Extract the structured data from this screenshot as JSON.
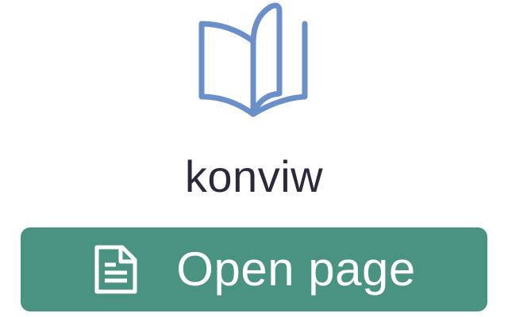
{
  "app": {
    "name": "konviw",
    "logo_icon": "open-book-icon",
    "accent_color": "#4a9382",
    "logo_color": "#6a8fc9"
  },
  "actions": {
    "open_page_label": "Open page",
    "open_page_icon": "document-icon"
  }
}
